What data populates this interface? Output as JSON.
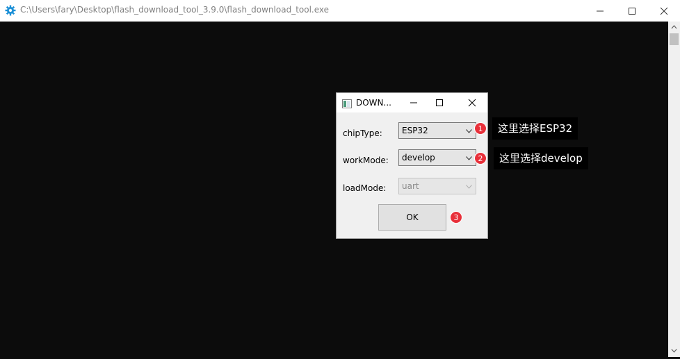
{
  "window": {
    "title": "C:\\Users\\fary\\Desktop\\flash_download_tool_3.9.0\\flash_download_tool.exe",
    "icon": "gear-icon"
  },
  "dialog": {
    "title": "DOWN...",
    "fields": [
      {
        "label": "chipType:",
        "value": "ESP32",
        "enabled": true
      },
      {
        "label": "workMode:",
        "value": "develop",
        "enabled": true
      },
      {
        "label": "loadMode:",
        "value": "uart",
        "enabled": false
      }
    ],
    "ok_label": "OK"
  },
  "annotations": [
    {
      "number": "1",
      "text": "这里选择ESP32"
    },
    {
      "number": "2",
      "text": "这里选择develop"
    },
    {
      "number": "3",
      "text": ""
    }
  ],
  "colors": {
    "badge": "#e8303a",
    "console_bg": "#0c0c0c",
    "gear_icon": "#1b8fd6"
  }
}
